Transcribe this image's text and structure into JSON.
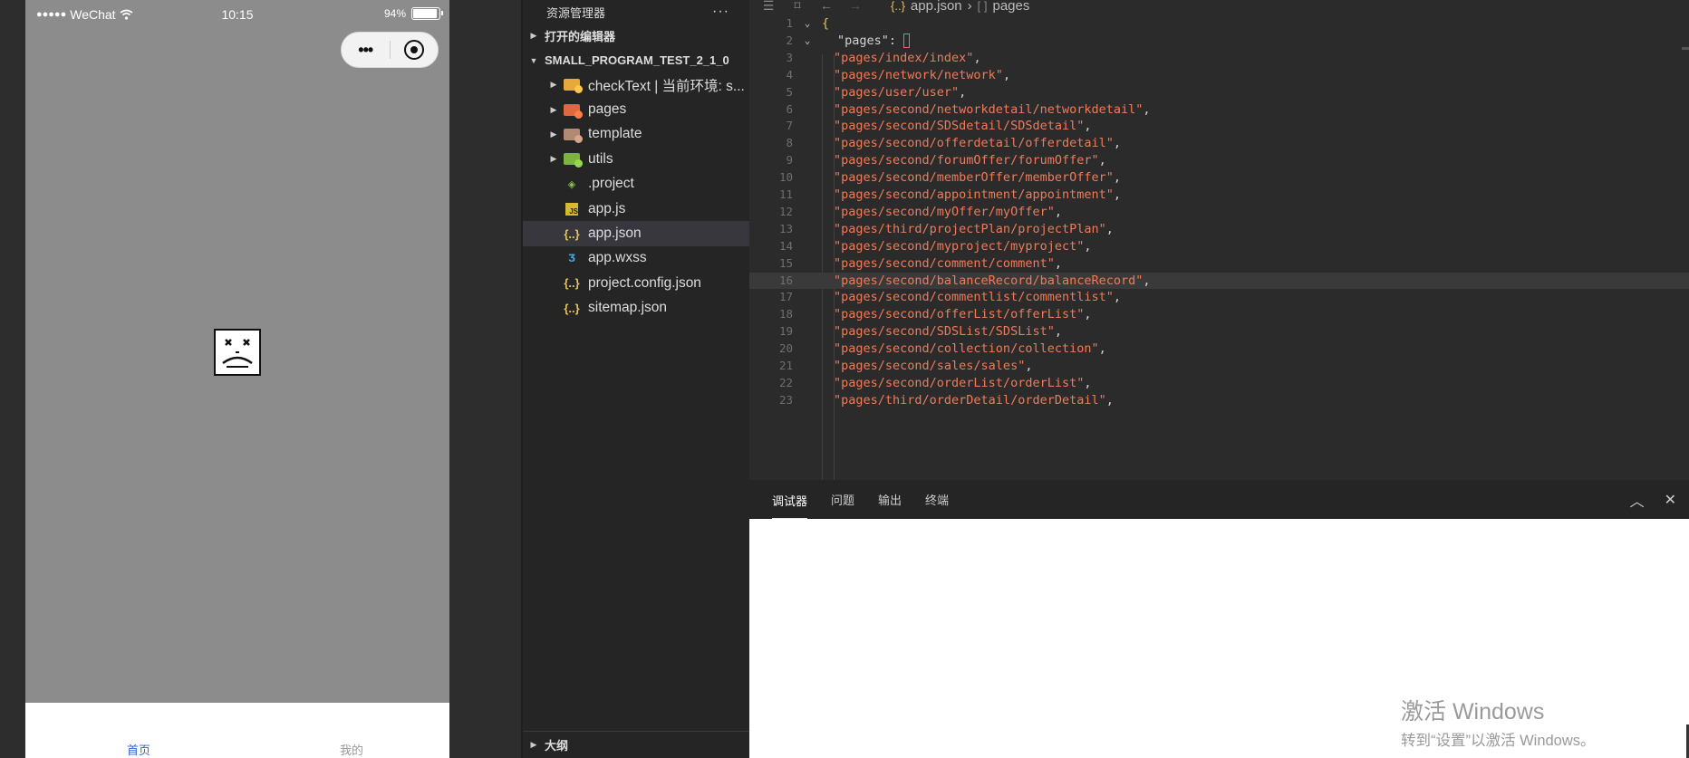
{
  "simulator": {
    "status_bar": {
      "signal_dots": "●●●●●",
      "carrier": "WeChat",
      "time": "10:15",
      "battery_percent_text": "94%",
      "battery_level": 0.94
    },
    "tabbar": {
      "home_label": "首页",
      "mine_label": "我的",
      "home_color": "#3b5fd1"
    }
  },
  "explorer": {
    "title": "资源管理器",
    "more": "···",
    "open_editors": "打开的编辑器",
    "project": "SMALL_PROGRAM_TEST_2_1_0",
    "items": [
      {
        "label": "checkText | 当前环境: s...",
        "icon": "folder-cloud-icon",
        "type": "folder"
      },
      {
        "label": "pages",
        "icon": "folder-pages-icon",
        "type": "folder"
      },
      {
        "label": "template",
        "icon": "folder-template-icon",
        "type": "folder"
      },
      {
        "label": "utils",
        "icon": "folder-utils-icon",
        "type": "folder"
      },
      {
        "label": ".project",
        "icon": "project-file-icon",
        "type": "file"
      },
      {
        "label": "app.js",
        "icon": "js-file-icon",
        "type": "file"
      },
      {
        "label": "app.json",
        "icon": "json-file-icon",
        "type": "file"
      },
      {
        "label": "app.wxss",
        "icon": "wxss-file-icon",
        "type": "file"
      },
      {
        "label": "project.config.json",
        "icon": "json-file-icon",
        "type": "file"
      },
      {
        "label": "sitemap.json",
        "icon": "json-file-icon",
        "type": "file"
      }
    ],
    "outline": "大纲"
  },
  "editor": {
    "breadcrumb": {
      "file": "app.json",
      "json_glyph": "{..}",
      "key_glyph": "[ ]",
      "key": "pages"
    },
    "lines": [
      {
        "n": "1",
        "text": "{"
      },
      {
        "n": "2",
        "key": "\"pages\"",
        "text": ": "
      },
      {
        "n": "3",
        "str": "\"pages/index/index\""
      },
      {
        "n": "4",
        "str": "\"pages/network/network\""
      },
      {
        "n": "5",
        "str": "\"pages/user/user\""
      },
      {
        "n": "6",
        "str": "\"pages/second/networkdetail/networkdetail\""
      },
      {
        "n": "7",
        "str": "\"pages/second/SDSdetail/SDSdetail\""
      },
      {
        "n": "8",
        "str": "\"pages/second/offerdetail/offerdetail\""
      },
      {
        "n": "9",
        "str": "\"pages/second/forumOffer/forumOffer\""
      },
      {
        "n": "10",
        "str": "\"pages/second/memberOffer/memberOffer\""
      },
      {
        "n": "11",
        "str": "\"pages/second/appointment/appointment\""
      },
      {
        "n": "12",
        "str": "\"pages/second/myOffer/myOffer\""
      },
      {
        "n": "13",
        "str": "\"pages/third/projectPlan/projectPlan\""
      },
      {
        "n": "14",
        "str": "\"pages/second/myproject/myproject\""
      },
      {
        "n": "15",
        "str": "\"pages/second/comment/comment\""
      },
      {
        "n": "16",
        "str": "\"pages/second/balanceRecord/balanceRecord\""
      },
      {
        "n": "17",
        "str": "\"pages/second/commentlist/commentlist\""
      },
      {
        "n": "18",
        "str": "\"pages/second/offerList/offerList\""
      },
      {
        "n": "19",
        "str": "\"pages/second/SDSList/SDSList\""
      },
      {
        "n": "20",
        "str": "\"pages/second/collection/collection\""
      },
      {
        "n": "21",
        "str": "\"pages/second/sales/sales\""
      },
      {
        "n": "22",
        "str": "\"pages/second/orderList/orderList\""
      },
      {
        "n": "23",
        "str": "\"pages/third/orderDetail/orderDetail\""
      }
    ],
    "comma": ",",
    "colors": {
      "string": "#ef7b5a",
      "key": "#9cdcfe"
    }
  },
  "panel": {
    "tabs": [
      "调试器",
      "问题",
      "输出",
      "终端"
    ],
    "active_tab": "调试器",
    "collapse_glyph": "︿",
    "close_glyph": "✕"
  },
  "watermark": {
    "line1": "激活 Windows",
    "line2": "转到“设置”以激活 Windows。"
  }
}
